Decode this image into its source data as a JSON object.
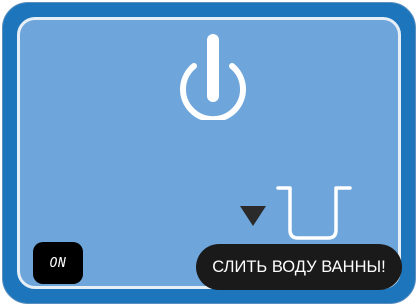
{
  "status": {
    "label": "ON"
  },
  "drain": {
    "button_label": "СЛИТЬ ВОДУ ВАННЫ!"
  },
  "icons": {
    "power": "power-icon",
    "arrow": "down-arrow-icon",
    "basin": "basin-drain-icon"
  },
  "colors": {
    "frame": "#1d75bc",
    "panel": "#6ea6dc",
    "panel_border": "#e6eef6",
    "button_bg": "#1a1a1a",
    "text": "#ffffff"
  }
}
